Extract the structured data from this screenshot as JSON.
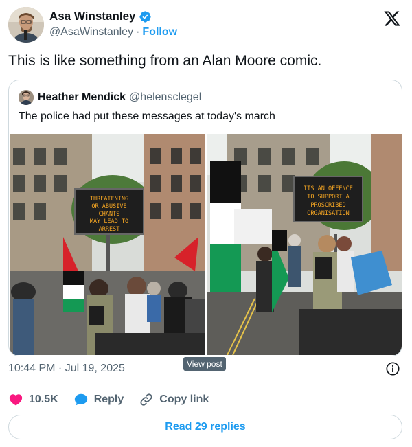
{
  "author": {
    "display_name": "Asa Winstanley",
    "handle": "@AsaWinstanley",
    "separator": "·",
    "follow_label": "Follow"
  },
  "tweet": {
    "text": "This is like something from an Alan Moore comic.",
    "timestamp": "10:44 PM · Jul 19, 2025"
  },
  "quote": {
    "display_name": "Heather Mendick",
    "handle": "@helensclegel",
    "text": "The police had put these messages at today's march",
    "sign_left": [
      "THREATENING",
      "OR ABUSIVE",
      "CHANTS",
      "MAY LEAD TO",
      "ARREST"
    ],
    "sign_right": [
      "ITS AN OFFENCE",
      "TO SUPPORT A",
      "PROSCRIBED",
      "ORGANISATION"
    ]
  },
  "view_post_label": "View post",
  "actions": {
    "like_count": "10.5K",
    "reply_label": "Reply",
    "copy_link_label": "Copy link"
  },
  "read_replies_label": "Read 29 replies",
  "colors": {
    "accent": "#1d9bf0",
    "like": "#f91880",
    "text": "#0f1419",
    "secondary": "#536471",
    "sign_text": "#f5a623"
  },
  "icons": {
    "verified": "verified-badge-icon",
    "logo": "x-logo-icon",
    "info": "info-icon",
    "like": "heart-icon",
    "reply": "reply-bubble-icon",
    "copy": "link-icon"
  }
}
